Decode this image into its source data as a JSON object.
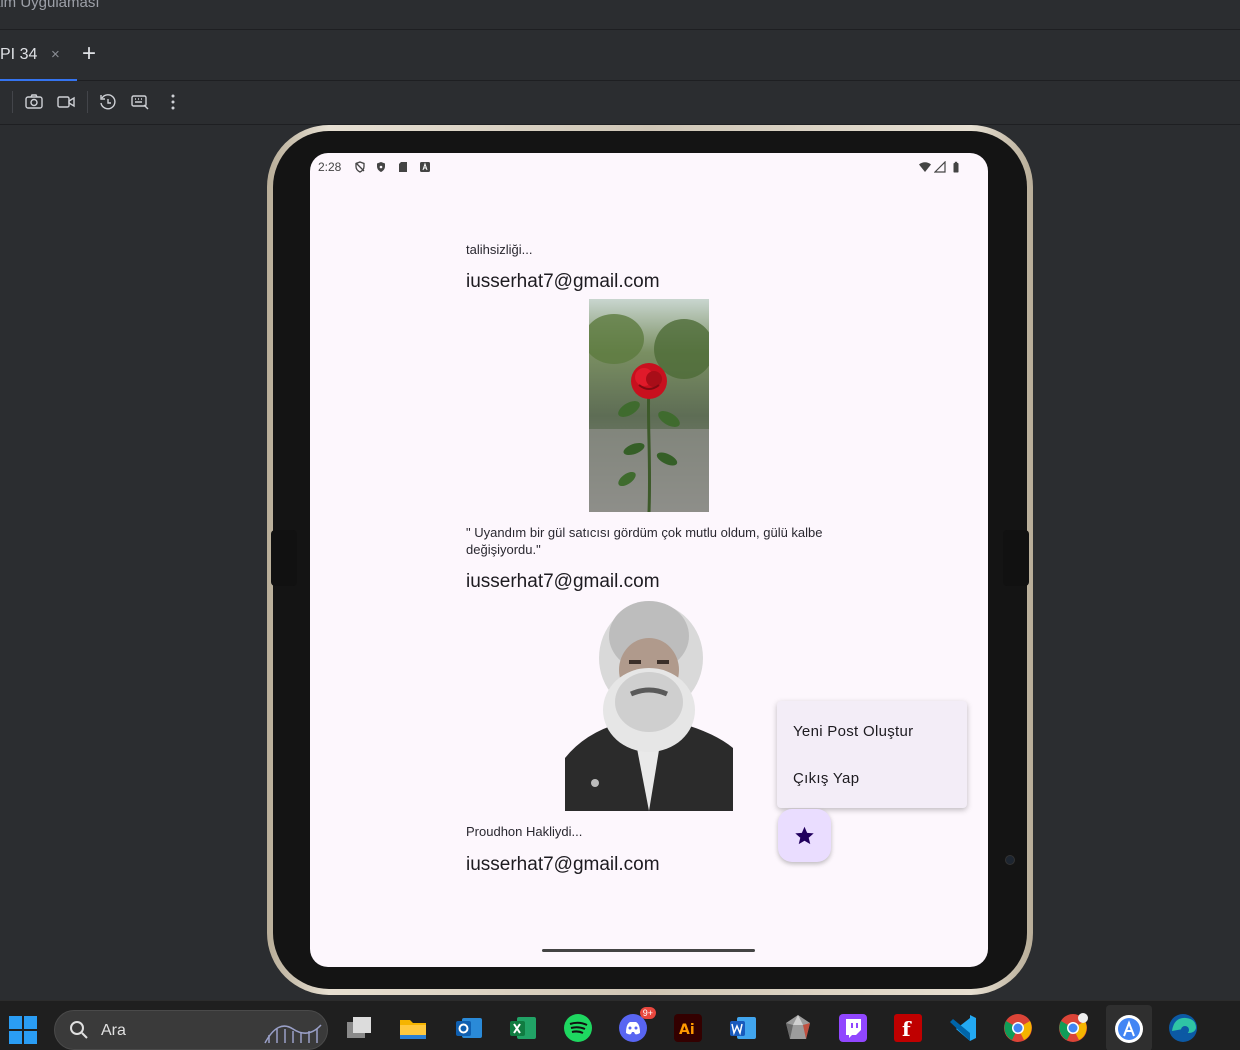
{
  "ide": {
    "window_title": "alm Uygulaması",
    "tab_label": "PI 34",
    "tab_close": "×",
    "add_tab": "+"
  },
  "toolbar": {
    "buttons": [
      "camera-icon",
      "video-icon",
      "rotate-icon",
      "keyboard-icon",
      "more-vert-icon"
    ]
  },
  "device": {
    "status_time": "2:28"
  },
  "feed": {
    "post1_text": "talihsizliği...",
    "post1_email": "iusserhat7@gmail.com",
    "post2_text": "\" Uyandım bir gül satıcısı gördüm çok mutlu oldum, gülü kalbe değişiyordu.\"",
    "post2_email": "iusserhat7@gmail.com",
    "post3_text": "Proudhon Hakliydi...",
    "post3_email": "iusserhat7@gmail.com"
  },
  "menu": {
    "item1": "Yeni Post Oluştur",
    "item2": "Çıkış Yap"
  },
  "taskbar": {
    "search_placeholder": "Ara",
    "discord_badge": "9+",
    "apps": [
      "windows-start-icon",
      "task-view-icon",
      "file-explorer-icon",
      "outlook-icon",
      "excel-icon",
      "spotify-icon",
      "discord-icon",
      "illustrator-icon",
      "word-icon",
      "app-gem-icon",
      "twitch-icon",
      "filezilla-icon",
      "vscode-icon",
      "chrome-icon",
      "chrome-profile-icon",
      "android-studio-icon",
      "edge-icon"
    ]
  },
  "colors": {
    "accent": "#3574f0",
    "screen_bg": "#fdf7fd",
    "menu_bg": "#f3edf7",
    "fab_bg": "#eaddff",
    "fab_icon": "#21005d"
  }
}
